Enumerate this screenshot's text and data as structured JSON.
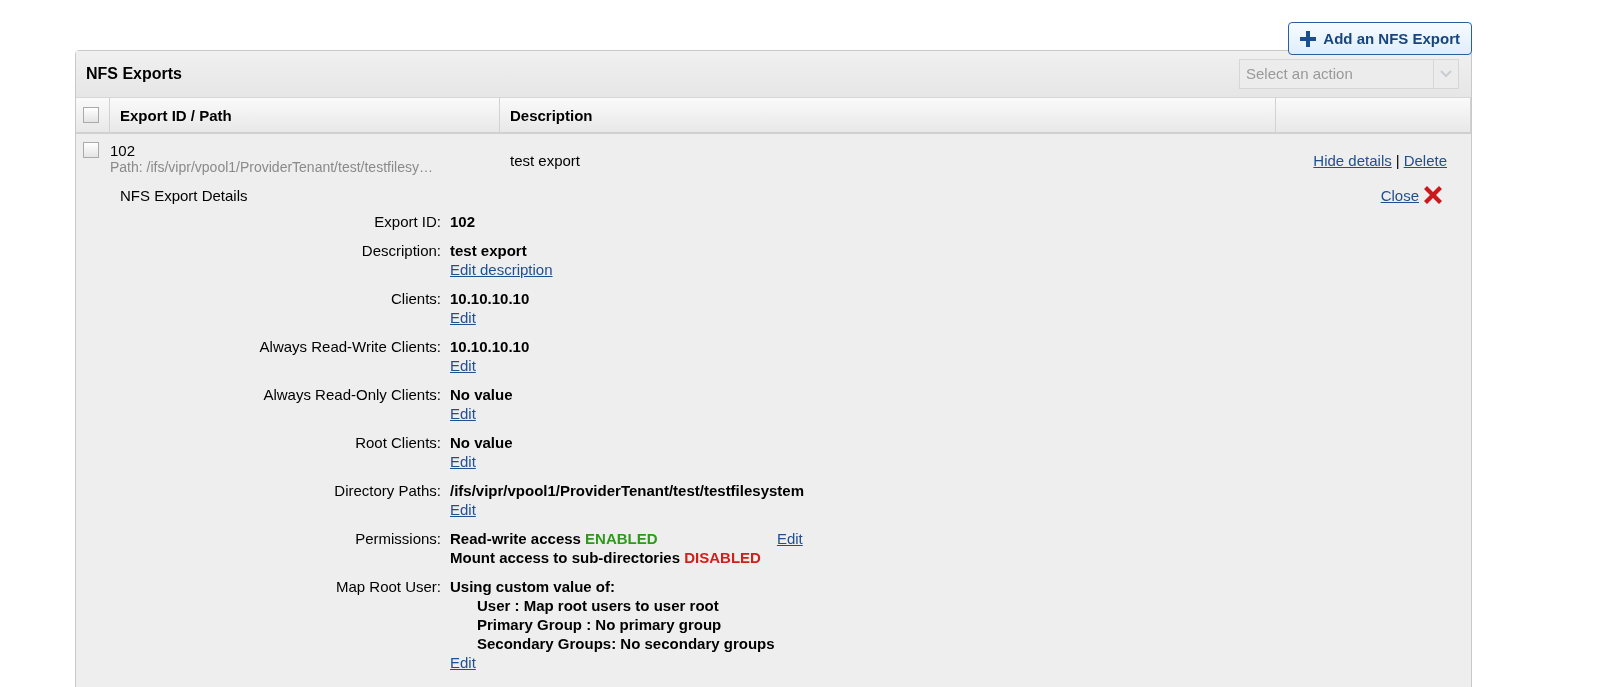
{
  "add_button": {
    "label": "Add an NFS Export"
  },
  "panel": {
    "title": "NFS Exports",
    "action_select": {
      "placeholder": "Select an action"
    }
  },
  "table": {
    "select_all": {
      "checked": false
    },
    "columns": [
      "Export ID / Path",
      "Description"
    ],
    "rows": [
      {
        "checked": false,
        "id": "102",
        "path": "Path: /ifs/vipr/vpool1/ProviderTenant/test/testfilesy…",
        "description": "test export",
        "actions": [
          "Hide details",
          "Delete"
        ],
        "separator": "|",
        "details": {
          "title": "NFS Export Details",
          "close": "Close",
          "fields": [
            {
              "kind": "value",
              "label": "Export ID:",
              "value": "102"
            },
            {
              "kind": "value",
              "label": "Description:",
              "value": "test export",
              "edit": "Edit description"
            },
            {
              "kind": "value",
              "label": "Clients:",
              "value": "10.10.10.10",
              "edit": "Edit"
            },
            {
              "kind": "value",
              "label": "Always Read-Write Clients:",
              "value": "10.10.10.10",
              "edit": "Edit"
            },
            {
              "kind": "value",
              "label": "Always Read-Only Clients:",
              "value": "No value",
              "edit": "Edit"
            },
            {
              "kind": "value",
              "label": "Root Clients:",
              "value": "No value",
              "edit": "Edit"
            },
            {
              "kind": "value",
              "label": "Directory Paths:",
              "value": "/ifs/vipr/vpool1/ProviderTenant/test/testfilesystem",
              "edit": "Edit"
            },
            {
              "kind": "permissions",
              "label": "Permissions:",
              "lines": [
                {
                  "text": "Read-write access",
                  "status": "ENABLED",
                  "color": "#2e9a1c"
                },
                {
                  "text": "Mount access to sub-directories",
                  "status": "DISABLED",
                  "color": "#d0201a"
                }
              ],
              "edit": "Edit"
            },
            {
              "kind": "list",
              "label": "Map Root User:",
              "value": "Using custom value of:",
              "lines": [
                "User : Map root users to user root",
                "Primary Group : No primary group",
                "Secondary Groups: No secondary groups"
              ],
              "edit": "Edit"
            }
          ]
        }
      }
    ]
  }
}
